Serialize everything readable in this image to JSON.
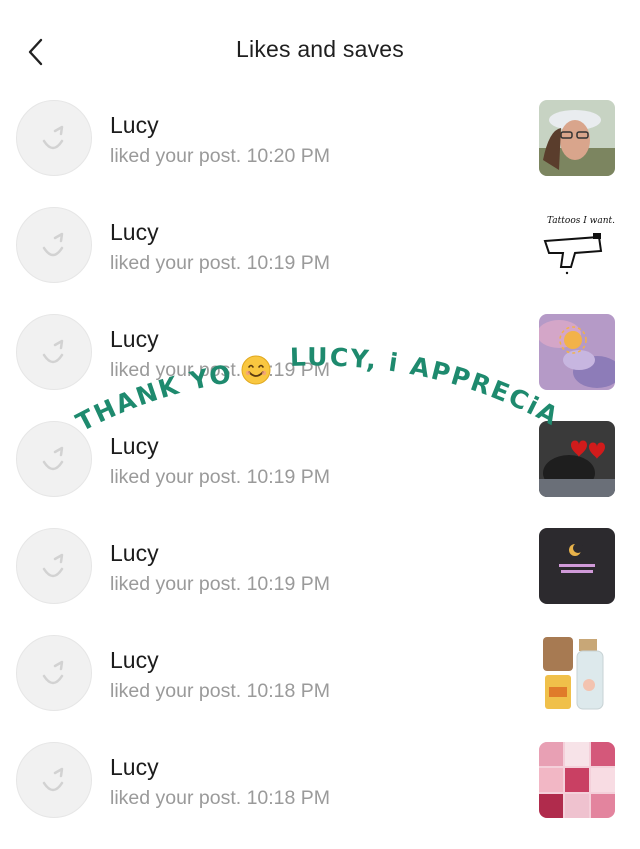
{
  "header": {
    "title": "Likes and saves",
    "back_icon": "chevron-left-icon"
  },
  "notifications": [
    {
      "name": "Lucy",
      "text": "liked your post. 10:20 PM",
      "thumb": "selfie-thumb"
    },
    {
      "name": "Lucy",
      "text": "liked your post. 10:19 PM",
      "thumb": "tattoo-sketch-thumb"
    },
    {
      "name": "Lucy",
      "text": "liked your post. 10:19 PM",
      "thumb": "tie-dye-shirt-thumb"
    },
    {
      "name": "Lucy",
      "text": "liked your post. 10:19 PM",
      "thumb": "cat-hearts-thumb"
    },
    {
      "name": "Lucy",
      "text": "liked your post. 10:19 PM",
      "thumb": "dark-moon-thumb"
    },
    {
      "name": "Lucy",
      "text": "liked your post. 10:18 PM",
      "thumb": "products-thumb"
    },
    {
      "name": "Lucy",
      "text": "liked your post. 10:18 PM",
      "thumb": "pink-collage-thumb"
    }
  ],
  "overlay": {
    "text_left": "THANK YOU",
    "text_right": "LUCY, i APPRECiATE",
    "color": "#1e8a6e",
    "emoji": "smiling-face-emoji"
  }
}
